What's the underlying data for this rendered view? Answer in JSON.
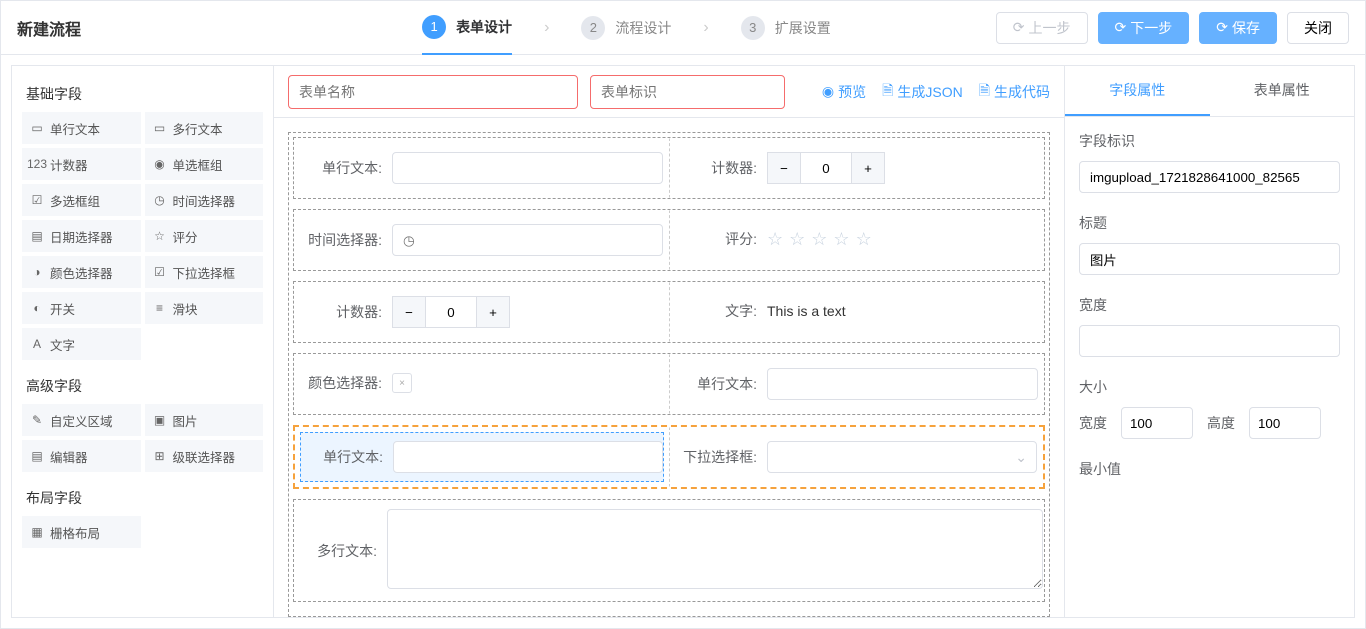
{
  "header": {
    "title": "新建流程",
    "steps": [
      {
        "num": "1",
        "label": "表单设计",
        "active": true
      },
      {
        "num": "2",
        "label": "流程设计",
        "active": false
      },
      {
        "num": "3",
        "label": "扩展设置",
        "active": false
      }
    ],
    "actions": {
      "prev": "上一步",
      "next": "下一步",
      "save": "保存",
      "close": "关闭"
    }
  },
  "left": {
    "groups": [
      {
        "title": "基础字段",
        "items": [
          {
            "icon": "▭",
            "label": "单行文本"
          },
          {
            "icon": "▭",
            "label": "多行文本"
          },
          {
            "icon": "123",
            "label": "计数器"
          },
          {
            "icon": "◉",
            "label": "单选框组"
          },
          {
            "icon": "☑",
            "label": "多选框组"
          },
          {
            "icon": "◷",
            "label": "时间选择器"
          },
          {
            "icon": "▤",
            "label": "日期选择器"
          },
          {
            "icon": "☆",
            "label": "评分"
          },
          {
            "icon": "◑",
            "label": "颜色选择器"
          },
          {
            "icon": "☑",
            "label": "下拉选择框"
          },
          {
            "icon": "◐",
            "label": "开关"
          },
          {
            "icon": "≡",
            "label": "滑块"
          },
          {
            "icon": "A",
            "label": "文字"
          }
        ]
      },
      {
        "title": "高级字段",
        "items": [
          {
            "icon": "✎",
            "label": "自定义区域"
          },
          {
            "icon": "▣",
            "label": "图片"
          },
          {
            "icon": "▤",
            "label": "编辑器"
          },
          {
            "icon": "⊞",
            "label": "级联选择器"
          }
        ]
      },
      {
        "title": "布局字段",
        "items": [
          {
            "icon": "▦",
            "label": "栅格布局"
          }
        ]
      }
    ]
  },
  "center": {
    "form_name_placeholder": "表单名称",
    "form_key_placeholder": "表单标识",
    "actions": {
      "preview": "预览",
      "gen_json": "生成JSON",
      "gen_code": "生成代码"
    },
    "rows": [
      {
        "cells": [
          {
            "label": "单行文本:",
            "type": "input"
          },
          {
            "label": "计数器:",
            "type": "stepper",
            "value": "0"
          }
        ]
      },
      {
        "cells": [
          {
            "label": "时间选择器:",
            "type": "time"
          },
          {
            "label": "评分:",
            "type": "rate"
          }
        ]
      },
      {
        "cells": [
          {
            "label": "计数器:",
            "type": "stepper",
            "value": "0"
          },
          {
            "label": "文字:",
            "type": "text",
            "value": "This is a text"
          }
        ]
      },
      {
        "cells": [
          {
            "label": "颜色选择器:",
            "type": "color"
          },
          {
            "label": "单行文本:",
            "type": "input"
          }
        ]
      },
      {
        "selected": true,
        "cells": [
          {
            "label": "单行文本:",
            "type": "input",
            "selected": true
          },
          {
            "label": "下拉选择框:",
            "type": "select"
          }
        ]
      },
      {
        "standalone": true,
        "label": "多行文本:",
        "type": "textarea"
      }
    ]
  },
  "right": {
    "tabs": {
      "field_props": "字段属性",
      "form_props": "表单属性"
    },
    "props": {
      "field_id_label": "字段标识",
      "field_id_value": "imgupload_1721828641000_82565",
      "title_label": "标题",
      "title_value": "图片",
      "width_label": "宽度",
      "width_value": "",
      "size_label": "大小",
      "size_w_label": "宽度",
      "size_w_value": "100",
      "size_h_label": "高度",
      "size_h_value": "100",
      "min_label": "最小值"
    }
  }
}
